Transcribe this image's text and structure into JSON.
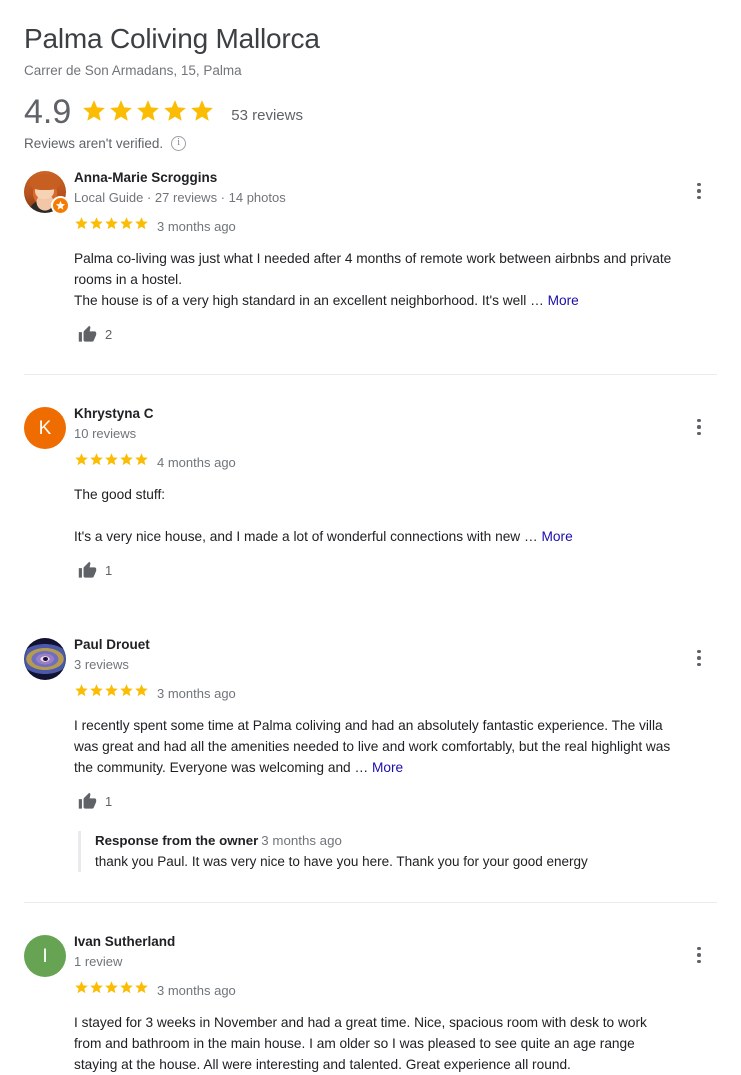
{
  "header": {
    "title": "Palma Coliving Mallorca",
    "address": "Carrer de Son Armadans, 15, Palma",
    "rating_score": "4.9",
    "rating_stars": 5,
    "reviews_count": "53 reviews",
    "verified_note": "Reviews aren't verified.",
    "info_icon": "info-icon",
    "star_color": "#fbbc04"
  },
  "reviews": [
    {
      "name": "Anna-Marie Scroggins",
      "meta": "Local Guide · 27 reviews · 14 photos",
      "stars": 5,
      "time": "3 months ago",
      "avatar_type": "photo",
      "avatar_letter": "",
      "local_guide_badge": true,
      "text": "Palma co-living was just what I needed after 4 months of remote work between airbnbs and private rooms in a hostel.\nThe house is of a very high standard in an excellent neighborhood. It's well ",
      "ellipsis": "…",
      "more_label": "More",
      "likes": "2",
      "thumb_icon": "thumbs-up-icon",
      "menu_icon": "more-options-icon",
      "owner_response": null
    },
    {
      "name": "Khrystyna C",
      "meta": "10 reviews",
      "stars": 5,
      "time": "4 months ago",
      "avatar_type": "letter",
      "avatar_letter": "K",
      "avatar_color": "#ef6c00",
      "local_guide_badge": false,
      "text": "The good stuff:\n\nIt's a very nice house, and I made a lot of wonderful connections with new ",
      "ellipsis": "…",
      "more_label": "More",
      "likes": "1",
      "thumb_icon": "thumbs-up-icon",
      "menu_icon": "more-options-icon",
      "owner_response": null
    },
    {
      "name": "Paul Drouet",
      "meta": "3 reviews",
      "stars": 5,
      "time": "3 months ago",
      "avatar_type": "galaxy",
      "avatar_letter": "",
      "local_guide_badge": false,
      "text": "I recently spent some time at Palma coliving and had an absolutely fantastic experience. The villa was great and had all the amenities needed to live and work comfortably, but the real highlight was the community. Everyone was welcoming and ",
      "ellipsis": "…",
      "more_label": "More",
      "likes": "1",
      "thumb_icon": "thumbs-up-icon",
      "menu_icon": "more-options-icon",
      "owner_response": {
        "title": "Response from the owner",
        "time": "3 months ago",
        "text": "thank you Paul. It was very nice to have you here. Thank you for your good energy"
      }
    },
    {
      "name": "Ivan Sutherland",
      "meta": "1 review",
      "stars": 5,
      "time": "3 months ago",
      "avatar_type": "letter",
      "avatar_letter": "I",
      "avatar_color": "#66a352",
      "local_guide_badge": false,
      "text": "I stayed for 3 weeks in November and had a great time. Nice, spacious room with desk to work from and bathroom in the main house. I am older so I was pleased to see quite an age range staying at the house. All were interesting and talented. Great experience all round.",
      "ellipsis": "",
      "more_label": "",
      "likes": "",
      "thumb_icon": "thumbs-up-icon",
      "menu_icon": "more-options-icon",
      "owner_response": null
    }
  ]
}
